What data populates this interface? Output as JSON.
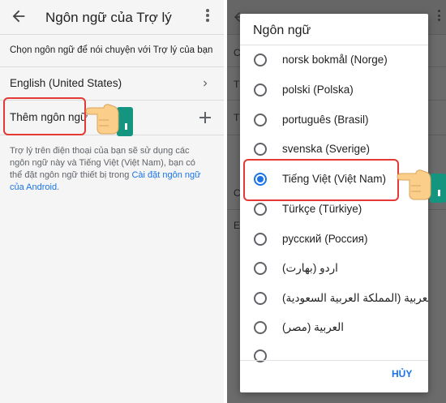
{
  "left": {
    "title": "Ngôn ngữ của Trợ lý",
    "subtitle": "Chọn ngôn ngữ để nói chuyện với Trợ lý của bạn",
    "current_language": "English (United States)",
    "add_language": "Thêm ngôn ngữ",
    "description": "Trợ lý trên điện thoại của bạn sẽ sử dụng các ngôn ngữ này và Tiếng Việt (Việt Nam), bạn có thể đặt ngôn ngữ thiết bị trong ",
    "description_link": "Cài đặt ngôn ngữ của Android",
    "description_end": "."
  },
  "background_letters": [
    "C",
    "T",
    "T",
    "C",
    "E"
  ],
  "dialog": {
    "title": "Ngôn ngữ",
    "options": [
      {
        "label": "norsk bokmål (Norge)",
        "selected": false
      },
      {
        "label": "polski (Polska)",
        "selected": false
      },
      {
        "label": "português (Brasil)",
        "selected": false
      },
      {
        "label": "svenska (Sverige)",
        "selected": false
      },
      {
        "label": "Tiếng Việt (Việt Nam)",
        "selected": true
      },
      {
        "label": "Türkçe (Türkiye)",
        "selected": false
      },
      {
        "label": "русский (Россия)",
        "selected": false
      },
      {
        "label": "اردو (بھارت)",
        "selected": false
      },
      {
        "label": "العربية (المملكة العربية السعودية)",
        "selected": false
      },
      {
        "label": "العربية (مصر)",
        "selected": false
      },
      {
        "label": "",
        "selected": false
      }
    ],
    "cancel_label": "HỦY"
  },
  "colors": {
    "accent": "#1a73e8",
    "highlight": "#e53935",
    "overlay": "#6b6b6b"
  },
  "icons": [
    "back-arrow-icon",
    "more-vert-icon",
    "chevron-right-icon",
    "plus-icon",
    "pointing-hand-icon",
    "radio-icon"
  ]
}
